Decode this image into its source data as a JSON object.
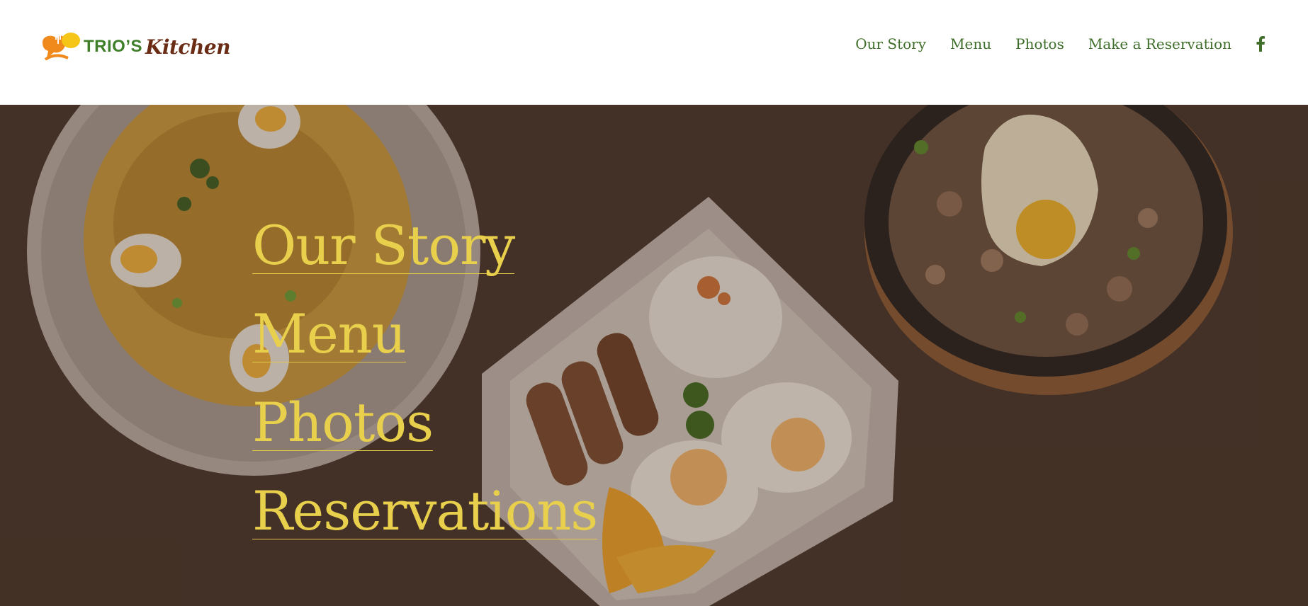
{
  "brand": {
    "name_part1": "TRIO’S",
    "name_part2": "Kitchen",
    "colors": {
      "orange": "#f08a1c",
      "yellow": "#f5c518",
      "green": "#3f7f2a",
      "brown": "#6a2c14"
    }
  },
  "nav": {
    "items": [
      {
        "label": "Our Story"
      },
      {
        "label": "Menu"
      },
      {
        "label": "Photos"
      },
      {
        "label": "Make a Reservation"
      }
    ],
    "social_icon": "facebook-icon"
  },
  "hero": {
    "background_color": "#46342a",
    "link_color": "#e8cf4c",
    "links": [
      {
        "label": "Our Story"
      },
      {
        "label": "Menu"
      },
      {
        "label": "Photos"
      },
      {
        "label": "Reservations"
      }
    ],
    "images": [
      "arroz-caldo-bowl",
      "breakfast-plate-longganisa",
      "sizzling-sisig-plate"
    ]
  }
}
